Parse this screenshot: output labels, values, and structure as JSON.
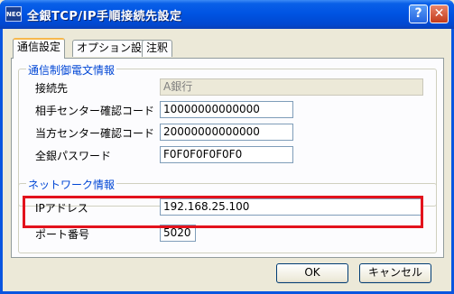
{
  "window": {
    "title": "全銀TCP/IP手順接続先設定",
    "app_icon_text": "NEO"
  },
  "title_buttons": {
    "help": "?",
    "close": "✕"
  },
  "tabs": [
    {
      "label": "通信設定",
      "active": true
    },
    {
      "label": "オプション設定",
      "active": false
    },
    {
      "label": "注釈",
      "active": false
    }
  ],
  "comm_group": {
    "title": "通信制御電文情報",
    "connection": {
      "label": "接続先",
      "value": "A銀行"
    },
    "partner_center": {
      "label": "相手センター確認コード",
      "value": "10000000000000"
    },
    "our_center": {
      "label": "当方センター確認コード",
      "value": "20000000000000"
    },
    "password": {
      "label": "全銀パスワード",
      "value": "F0F0F0F0F0F0"
    }
  },
  "network_group": {
    "title": "ネットワーク情報",
    "ip": {
      "label": "IPアドレス",
      "value": "192.168.25.100"
    },
    "port": {
      "label": "ポート番号",
      "value": "5020"
    }
  },
  "buttons": {
    "ok": "OK",
    "cancel": "キャンセル"
  },
  "colors": {
    "highlight": "#e3121c",
    "group_title": "#0046d5",
    "titlebar": "#0054e3"
  }
}
